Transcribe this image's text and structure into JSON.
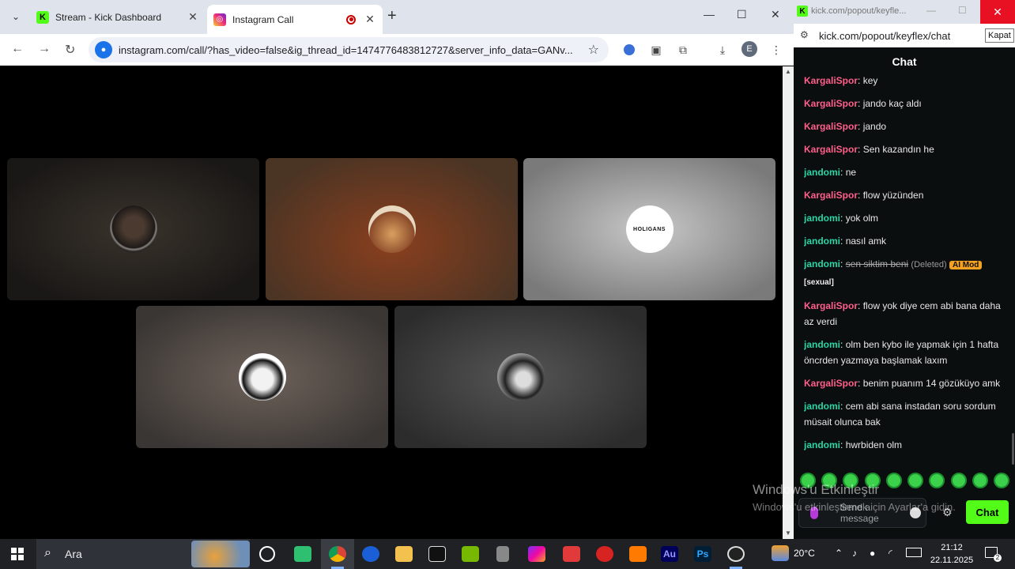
{
  "browser": {
    "tabs": [
      {
        "title": "Stream - Kick Dashboard",
        "active": false
      },
      {
        "title": "Instagram Call",
        "active": true
      }
    ],
    "url": "instagram.com/call/?has_video=false&ig_thread_id=1474776483812727&server_info_data=GANv...",
    "profile_initial": "E"
  },
  "call": {
    "participants": [
      {
        "id": "p1",
        "bg": "#2b2622"
      },
      {
        "id": "p2",
        "bg": "#6a3b22"
      },
      {
        "id": "p3",
        "bg": "#9a9a9a"
      },
      {
        "id": "p4",
        "bg": "#5b5350"
      },
      {
        "id": "p5",
        "bg": "#555"
      }
    ],
    "p3_logo_text": "HOLIGANS"
  },
  "popout": {
    "title": "kick.com/popout/keyfle...",
    "url": "kick.com/popout/keyflex/chat",
    "tooltip": "Kapat",
    "header": "Chat",
    "messages": [
      {
        "user": "KargaliSpor",
        "text": "key",
        "type": "k"
      },
      {
        "user": "KargaliSpor",
        "text": "jando kaç aldı",
        "type": "k"
      },
      {
        "user": "KargaliSpor",
        "text": "jando",
        "type": "k"
      },
      {
        "user": "KargaliSpor",
        "text": "Sen kazandın he",
        "type": "k"
      },
      {
        "user": "jandomi",
        "text": "ne",
        "type": "j"
      },
      {
        "user": "KargaliSpor",
        "text": "flow yüzünden",
        "type": "k"
      },
      {
        "user": "jandomi",
        "text": "yok olm",
        "type": "j"
      },
      {
        "user": "jandomi",
        "text": "nasıl amk",
        "type": "j"
      },
      {
        "user": "jandomi",
        "text": "sen siktim beni",
        "type": "j",
        "deleted": true,
        "deleted_label": "(Deleted)",
        "mod_label": "AI Mod",
        "reason": "[sexual]"
      },
      {
        "user": "KargaliSpor",
        "text": "flow yok diye cem abi bana daha az verdi",
        "type": "k"
      },
      {
        "user": "jandomi",
        "text": "olm ben kybo ile yapmak için 1 hafta öncrden yazmaya başlamak laxım",
        "type": "j"
      },
      {
        "user": "KargaliSpor",
        "text": "benim puanım 14 gözüküyo amk",
        "type": "k"
      },
      {
        "user": "jandomi",
        "text": "cem abi sana instadan soru sordum müsait olunca bak",
        "type": "j"
      },
      {
        "user": "jandomi",
        "text": "hwrbiden olm",
        "type": "j"
      }
    ],
    "input_placeholder": "Send a message",
    "chat_button": "Chat"
  },
  "watermark": {
    "line1": "Windows'u Etkinleştir",
    "line2": "Windows'u etkinleştirmek için Ayarlar'a gidin."
  },
  "taskbar": {
    "search_label": "Ara",
    "temperature": "20°C",
    "time": "21:12",
    "date": "22.11.2025"
  },
  "colors": {
    "kick_green": "#53fc18",
    "user_k": "#ff5f8a",
    "user_j": "#2ad6a6"
  }
}
